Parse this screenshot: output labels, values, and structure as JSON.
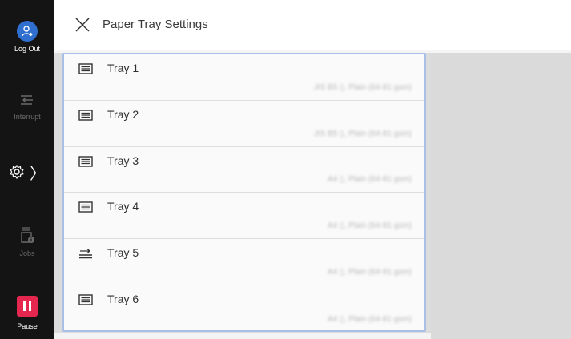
{
  "sidebar": {
    "logout_label": "Log Out",
    "interrupt_label": "Interrupt",
    "jobs_label": "Jobs",
    "pause_label": "Pause",
    "settings_chevron": "〉"
  },
  "header": {
    "title": "Paper Tray Settings"
  },
  "trays": [
    {
      "name": "Tray 1",
      "icon": "tray-stack-icon",
      "detail": "JIS B5 ▯, Plain (64-81 gsm)"
    },
    {
      "name": "Tray 2",
      "icon": "tray-stack-icon",
      "detail": "JIS B5 ▯, Plain (64-81 gsm)"
    },
    {
      "name": "Tray 3",
      "icon": "tray-stack-icon",
      "detail": "A4 ▯, Plain (64-81 gsm)"
    },
    {
      "name": "Tray 4",
      "icon": "tray-stack-icon",
      "detail": "A4 ▯, Plain (64-81 gsm)"
    },
    {
      "name": "Tray 5",
      "icon": "bypass-tray-icon",
      "detail": "A4 ▯, Plain (64-81 gsm)"
    },
    {
      "name": "Tray 6",
      "icon": "tray-stack-icon",
      "detail": "A4 ▯, Plain (64-81 gsm)"
    }
  ],
  "colors": {
    "accent_blue": "#2f6fd0",
    "pause_red": "#e5274f",
    "panel_border": "#a9bfe6"
  }
}
